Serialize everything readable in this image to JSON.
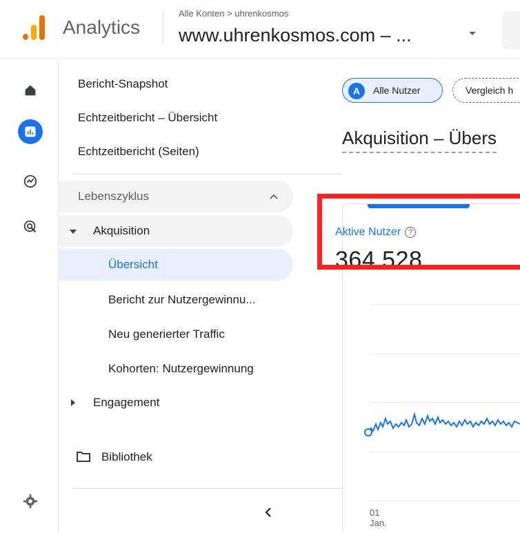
{
  "header": {
    "app_title": "Analytics",
    "breadcrumb": "Alle Konten > uhrenkosmos",
    "property": "www.uhrenkosmos.com – ...",
    "logo_colors": [
      "#f9ab00",
      "#e37400"
    ]
  },
  "rail": {
    "icons": [
      "home-icon",
      "reports-icon",
      "explore-icon",
      "advertising-icon",
      "settings-icon"
    ],
    "active": "reports-icon",
    "active_color": "#1a73e8"
  },
  "nav": {
    "top_items": [
      "Bericht-Snapshot",
      "Echtzeitbericht – Übersicht",
      "Echtzeitbericht (Seiten)"
    ],
    "section": "Lebenszyklus",
    "group": "Akquisition",
    "sub_items": [
      "Übersicht",
      "Bericht zur Nutzergewinnu...",
      "Neu generierter Traffic",
      "Kohorten: Nutzergewinnung"
    ],
    "active_sub": "Übersicht",
    "engagement": "Engagement",
    "library": "Bibliothek"
  },
  "main": {
    "chip_all_badge": "A",
    "chip_all": "Alle Nutzer",
    "chip_compare": "Vergleich h",
    "title": "Akquisition – Übers",
    "metric_label": "Aktive Nutzer",
    "metric_help": "?",
    "metric_value": "364.528",
    "axis_day": "01",
    "axis_month": "Jan.",
    "highlight_color": "#ff2222",
    "line_color": "#1a73e8"
  }
}
